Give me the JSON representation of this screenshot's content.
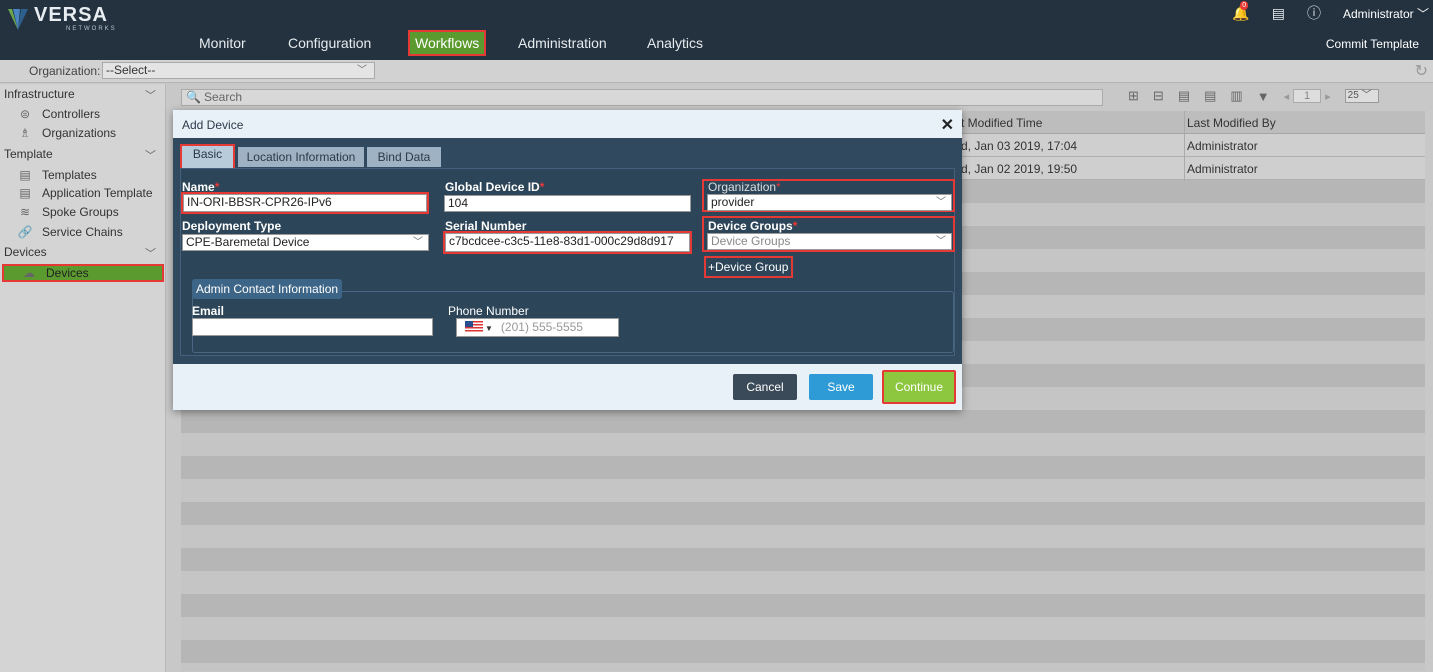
{
  "brand": {
    "name": "VERSA",
    "tagline": "NETWORKS"
  },
  "topnav": {
    "items": [
      {
        "label": "Monitor",
        "active": false
      },
      {
        "label": "Configuration",
        "active": false
      },
      {
        "label": "Workflows",
        "active": true
      },
      {
        "label": "Administration",
        "active": false
      },
      {
        "label": "Analytics",
        "active": false
      }
    ],
    "commit_label": "Commit Template",
    "notifications_count": "0",
    "user": "Administrator"
  },
  "orgbar": {
    "label": "Organization:",
    "value": "--Select--"
  },
  "sidebar": {
    "sections": [
      {
        "title": "Infrastructure",
        "items": [
          "Controllers",
          "Organizations"
        ]
      },
      {
        "title": "Template",
        "items": [
          "Templates",
          "Application Template",
          "Spoke Groups",
          "Service Chains"
        ]
      },
      {
        "title": "Devices",
        "items": [
          "Devices"
        ]
      }
    ]
  },
  "main": {
    "search_placeholder": "Search",
    "pager": {
      "page": "1",
      "page_size": "25"
    },
    "columns": [
      "t Modified Time",
      "Last Modified By"
    ],
    "rows": [
      {
        "modified_time": "d, Jan 03 2019, 17:04",
        "modified_by": "Administrator"
      },
      {
        "modified_time": "d, Jan 02 2019, 19:50",
        "modified_by": "Administrator"
      }
    ]
  },
  "modal": {
    "title": "Add Device",
    "tabs": [
      "Basic",
      "Location Information",
      "Bind Data"
    ],
    "fields": {
      "name": {
        "label": "Name",
        "value": "IN-ORI-BBSR-CPR26-IPv6"
      },
      "global_id": {
        "label": "Global Device ID",
        "value": "104"
      },
      "organization": {
        "label": "Organization",
        "value": "provider"
      },
      "deployment_type": {
        "label": "Deployment Type",
        "value": "CPE-Baremetal Device"
      },
      "serial_number": {
        "label": "Serial Number",
        "value": "c7bcdcee-c3c5-11e8-83d1-000c29d8d917"
      },
      "device_groups": {
        "label": "Device Groups",
        "placeholder": "Device Groups"
      }
    },
    "add_device_group": "+Device Group",
    "admin_contact": {
      "legend": "Admin Contact Information",
      "email_label": "Email",
      "email_value": "",
      "phone_label": "Phone Number",
      "phone_placeholder": "(201) 555-5555"
    },
    "buttons": {
      "cancel": "Cancel",
      "save": "Save",
      "continue": "Continue"
    }
  }
}
